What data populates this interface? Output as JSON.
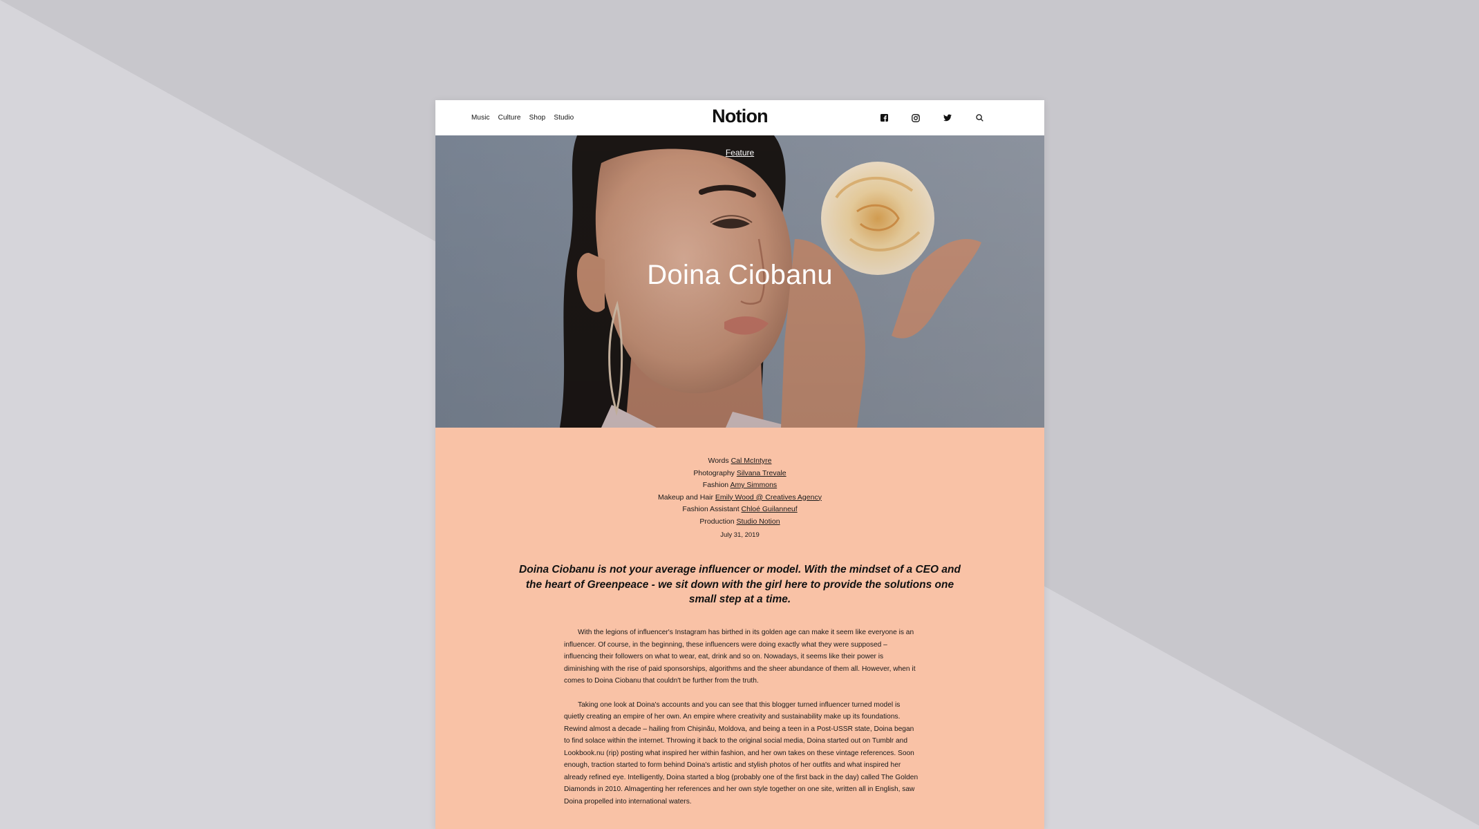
{
  "nav": {
    "items": [
      {
        "label": "Music"
      },
      {
        "label": "Culture"
      },
      {
        "label": "Shop"
      },
      {
        "label": "Studio"
      }
    ]
  },
  "logo": "Notion",
  "social": [
    "facebook-icon",
    "instagram-icon",
    "twitter-icon",
    "search-icon"
  ],
  "hero": {
    "tag": "Feature",
    "title": "Doina Ciobanu"
  },
  "credits": [
    {
      "role": "Words",
      "name": "Cal McIntyre"
    },
    {
      "role": "Photography",
      "name": "Silvana Trevale"
    },
    {
      "role": "Fashion",
      "name": "Amy Simmons"
    },
    {
      "role": "Makeup and Hair",
      "name": "Emily Wood @ Creatives Agency"
    },
    {
      "role": "Fashion Assistant",
      "name": "Chloé Guilanneuf"
    },
    {
      "role": "Production",
      "name": "Studio Notion"
    }
  ],
  "date": "July 31, 2019",
  "lede": "Doina Ciobanu is not your average influencer or model. With the mindset of a CEO and the heart of Greenpeace - we sit down with the girl here to provide the solutions one small step at a time.",
  "body": [
    "With the legions of influencer's Instagram has birthed in its golden age can make it seem like everyone is an influencer. Of course, in the beginning, these influencers were doing exactly what they were supposed – influencing their followers on what to wear, eat, drink and so on. Nowadays, it seems like their power is diminishing with the rise of paid sponsorships, algorithms and the sheer abundance of them all. However, when it comes to Doina Ciobanu that couldn't be further from the truth.",
    "Taking one look at Doina's accounts and you can see that this blogger turned influencer turned model is quietly creating an empire of her own. An empire where creativity and sustainability make up its foundations. Rewind almost a decade – hailing from Chișinău, Moldova, and being a teen in a Post-USSR state, Doina began to find solace within the internet. Throwing it back to the original social media, Doina started out on Tumblr and Lookbook.nu (rip) posting what inspired her within fashion, and her own takes on these vintage references. Soon enough, traction started to form behind Doina's artistic and stylish photos of her outfits and what inspired her already refined eye. Intelligently, Doina started a blog (probably one of the first back in the day) called The Golden Diamonds in 2010. Almagenting her references and her own style together on one site, written all in English, saw Doina propelled into international waters."
  ],
  "colors": {
    "backdrop": "#c8c7cc",
    "backdrop_light": "#d6d5da",
    "page_bg": "#f9c2a6",
    "header_bg": "#ffffff"
  }
}
